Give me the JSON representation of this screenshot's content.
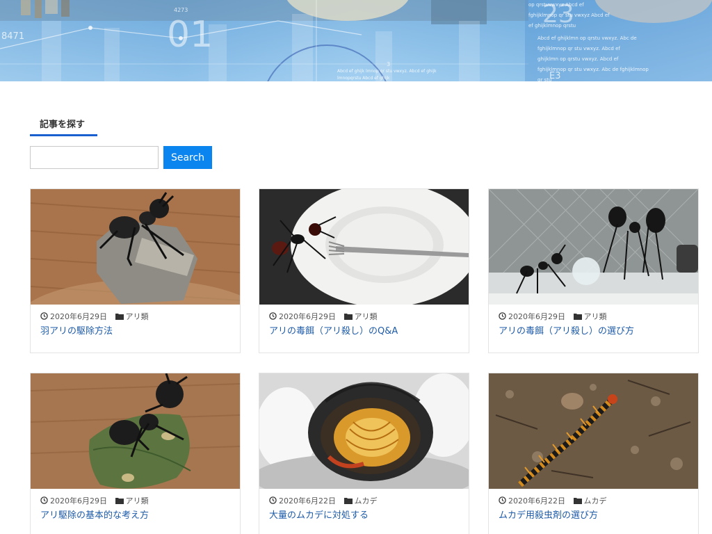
{
  "banner": {
    "numbers": [
      "8471",
      "01",
      "23",
      "3",
      "E3",
      "4273"
    ],
    "text_lines": [
      "op qrstuvwxyz Abcd ef",
      "fghijklmnop qr stu vwxyz Abcd ef",
      "ef ghijklmnop qrstu",
      "Abcd ef ghijklmn op qrstu vwxyz. Abc de",
      "fghijklmnop qr stu vwxyz. Abcd ef",
      "ghijklmn op qrstu vwxyz. Abcd ef",
      "fghijklmnop qr stu vwxyz. Abc de fghijklmnop qr stu",
      "qrstu vwxyz. Abcd ef ghijklmnop qrstu",
      "Abcd ef ghijk lmnop qr stu vwxyz. Abcd ef ghijk",
      "lmnopqrstu Abcd ef ghijk"
    ]
  },
  "search": {
    "widget_title": "記事を探す",
    "placeholder": "",
    "value": "",
    "button_label": "Search"
  },
  "cards": [
    {
      "date": "2020年6月29日",
      "category": "アリ類",
      "title": "羽アリの駆除方法",
      "image": "ant-on-rock"
    },
    {
      "date": "2020年6月29日",
      "category": "アリ類",
      "title": "アリの毒餌（アリ殺し）のQ&A",
      "image": "ant-with-fork-plate"
    },
    {
      "date": "2020年6月29日",
      "category": "アリ類",
      "title": "アリの毒餌（アリ殺し）の選び方",
      "image": "ants-by-window"
    },
    {
      "date": "2020年6月29日",
      "category": "アリ類",
      "title": "アリ駆除の基本的な考え方",
      "image": "ant-on-leaf"
    },
    {
      "date": "2020年6月22日",
      "category": "ムカデ",
      "title": "大量のムカデに対処する",
      "image": "centipede-bowl"
    },
    {
      "date": "2020年6月22日",
      "category": "ムカデ",
      "title": "ムカデ用殺虫剤の選び方",
      "image": "centipede-on-soil"
    }
  ],
  "icons": {
    "date": "clock-icon",
    "category": "folder-icon"
  },
  "colors": {
    "accent": "#1a5fd0",
    "button": "#0a84ee",
    "link": "#1e5ba8"
  }
}
